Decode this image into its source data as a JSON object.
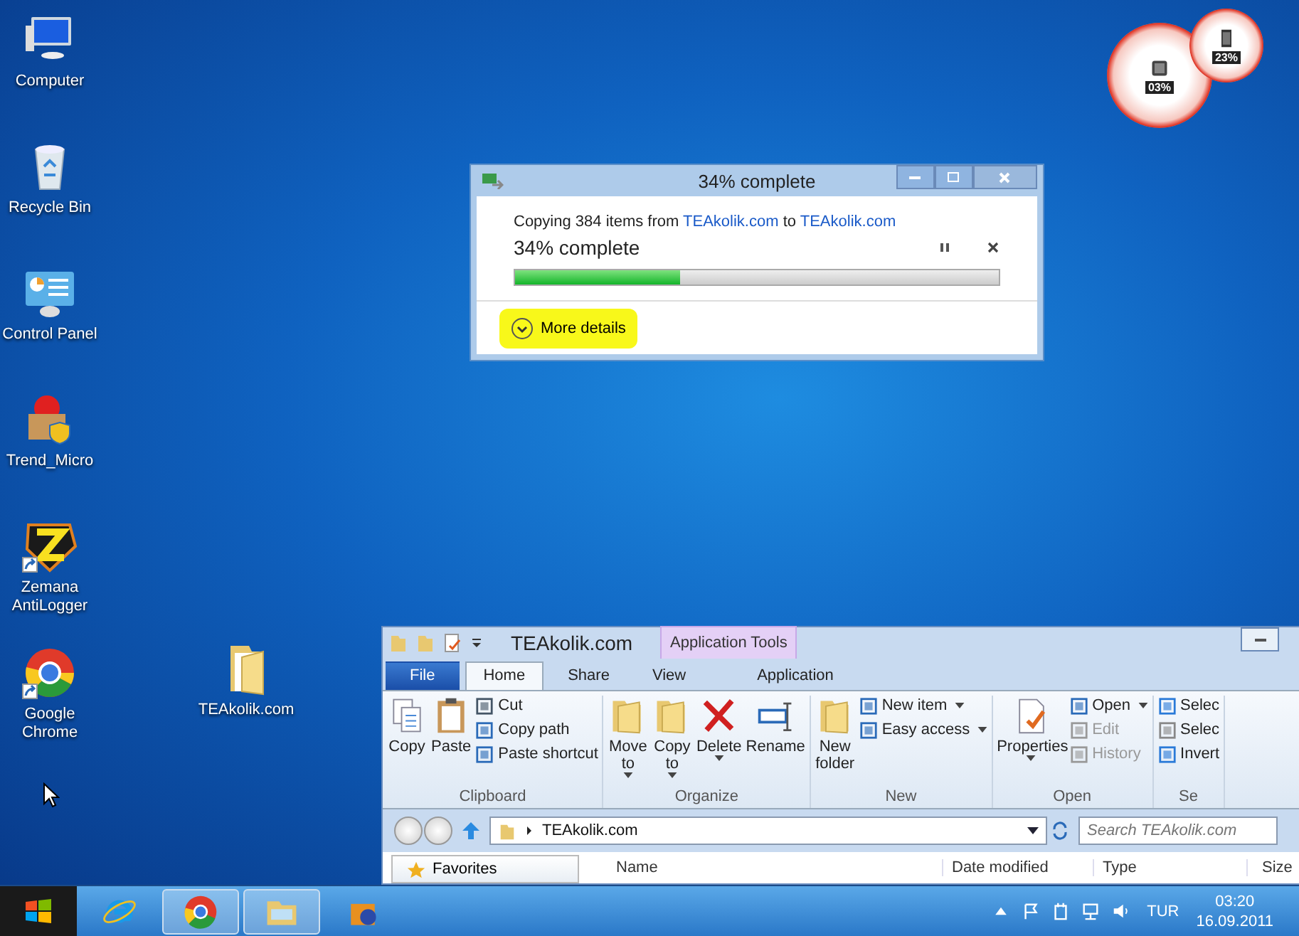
{
  "desktop_icons": [
    {
      "label": "Computer",
      "kind": "computer",
      "shortcut": false
    },
    {
      "label": "Recycle Bin",
      "kind": "recycle",
      "shortcut": false
    },
    {
      "label": "Control Panel",
      "kind": "control",
      "shortcut": false
    },
    {
      "label": "Trend_Micro",
      "kind": "box",
      "shortcut": false
    },
    {
      "label": "Zemana AntiLogger",
      "kind": "zemana",
      "shortcut": true
    },
    {
      "label": "Google Chrome",
      "kind": "chrome",
      "shortcut": true
    },
    {
      "label": "TEAkolik.com",
      "kind": "folder",
      "shortcut": false
    }
  ],
  "gadget": {
    "cpu_reading": "03%",
    "memory_reading": "23%"
  },
  "copy_dialog": {
    "title": "34% complete",
    "message_prefix": "Copying 384 items from",
    "source": "TEAkolik.com",
    "message_middle": "to",
    "destination": "TEAkolik.com",
    "status": "34% complete",
    "level": 0.34,
    "more_details": "More details",
    "highlighted": true
  },
  "explorer": {
    "title": "TEAkolik.com",
    "context_group": "Application Tools",
    "tabs": [
      {
        "label": "File",
        "kind": "file",
        "selected": false
      },
      {
        "label": "Home",
        "kind": "tab",
        "selected": true
      },
      {
        "label": "Share",
        "kind": "tab",
        "selected": false
      },
      {
        "label": "View",
        "kind": "tab",
        "selected": false
      },
      {
        "label": "Application",
        "kind": "context",
        "selected": false
      }
    ],
    "groups": [
      {
        "label": "Clipboard",
        "items": [
          {
            "label": "Copy",
            "kind": "large",
            "dropdown": false,
            "disabled": false
          },
          {
            "label": "Paste",
            "kind": "large",
            "dropdown": false,
            "disabled": false
          },
          {
            "label": "Cut",
            "kind": "small",
            "dropdown": false,
            "disabled": false
          },
          {
            "label": "Copy path",
            "kind": "small",
            "dropdown": false,
            "disabled": false
          },
          {
            "label": "Paste shortcut",
            "kind": "small",
            "dropdown": false,
            "disabled": false
          }
        ]
      },
      {
        "label": "Organize",
        "items": [
          {
            "label": "Move to",
            "kind": "large",
            "dropdown": true,
            "disabled": false
          },
          {
            "label": "Copy to",
            "kind": "large",
            "dropdown": true,
            "disabled": false
          },
          {
            "label": "Delete",
            "kind": "large",
            "dropdown": true,
            "disabled": false
          },
          {
            "label": "Rename",
            "kind": "large",
            "dropdown": false,
            "disabled": false
          }
        ]
      },
      {
        "label": "New",
        "items": [
          {
            "label": "New folder",
            "kind": "large",
            "dropdown": false,
            "disabled": false
          },
          {
            "label": "New item",
            "kind": "small",
            "dropdown": true,
            "disabled": false
          },
          {
            "label": "Easy access",
            "kind": "small",
            "dropdown": true,
            "disabled": false
          }
        ]
      },
      {
        "label": "Open",
        "items": [
          {
            "label": "Properties",
            "kind": "large",
            "dropdown": true,
            "disabled": false
          },
          {
            "label": "Open",
            "kind": "small",
            "dropdown": true,
            "disabled": false
          },
          {
            "label": "Edit",
            "kind": "small",
            "dropdown": false,
            "disabled": true
          },
          {
            "label": "History",
            "kind": "small",
            "dropdown": false,
            "disabled": true
          }
        ]
      },
      {
        "label": "Se",
        "items": [
          {
            "label": "Selec",
            "kind": "small",
            "dropdown": false,
            "disabled": false
          },
          {
            "label": "Selec",
            "kind": "small",
            "dropdown": false,
            "disabled": false
          },
          {
            "label": "Invert",
            "kind": "small",
            "dropdown": false,
            "disabled": false
          }
        ]
      }
    ],
    "address": "TEAkolik.com",
    "search": {
      "placeholder": "Search TEAkolik.com"
    },
    "nav_item": "Favorites",
    "columns": [
      "Name",
      "Date modified",
      "Type",
      "Size"
    ]
  },
  "taskbar": {
    "apps": [
      {
        "kind": "ie",
        "active": false
      },
      {
        "kind": "chrome",
        "active": true
      },
      {
        "kind": "explorer",
        "active": true
      },
      {
        "kind": "box",
        "active": false
      }
    ],
    "language": "TUR",
    "time": "03:20",
    "date": "16.09.2011"
  }
}
